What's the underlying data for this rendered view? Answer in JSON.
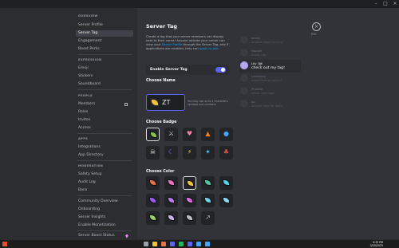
{
  "window": {
    "minimize_glyph": "–",
    "maximize_glyph": "□",
    "close_glyph": "×"
  },
  "sidebar": {
    "sections": [
      {
        "header": "Overview",
        "items": [
          {
            "label": "Server Profile"
          },
          {
            "label": "Server Tag",
            "active": true
          },
          {
            "label": "Engagement"
          },
          {
            "label": "Boost Perks"
          }
        ]
      },
      {
        "header": "Expression",
        "items": [
          {
            "label": "Emoji"
          },
          {
            "label": "Stickers"
          },
          {
            "label": "Soundboard"
          }
        ]
      },
      {
        "header": "People",
        "items": [
          {
            "label": "Members",
            "icon": "external-link-icon"
          },
          {
            "label": "Roles"
          },
          {
            "label": "Invites"
          },
          {
            "label": "Access"
          }
        ]
      },
      {
        "header": "Apps",
        "items": [
          {
            "label": "Integrations"
          },
          {
            "label": "App Directory"
          }
        ]
      },
      {
        "header": "Moderation",
        "items": [
          {
            "label": "Safety Setup"
          },
          {
            "label": "Audit Log"
          },
          {
            "label": "Bans"
          }
        ]
      },
      {
        "header": "",
        "items": [
          {
            "label": "Community Overview"
          },
          {
            "label": "Onboarding"
          },
          {
            "label": "Server Insights"
          },
          {
            "label": "Enable Monetization"
          }
        ]
      }
    ],
    "footer_item": {
      "label": "Server Boost Status",
      "icon": "nitro-gem-icon"
    }
  },
  "page": {
    "title": "Server Tag",
    "description_parts": [
      "Create a tag that your server members can display next to their name! Anyone outside your server can view your ",
      "Server Profile",
      " through the Server Tag, and if applications are enabled, they can ",
      "apply to join",
      "."
    ],
    "toggle": {
      "label": "Enable Server Tag",
      "enabled": true
    },
    "choose_name": {
      "heading": "Choose Name",
      "value": "ZT",
      "hint": "You may use up to 4 characters, symbols and numbers."
    },
    "choose_badge": {
      "heading": "Choose Badge"
    },
    "choose_color": {
      "heading": "Choose Color"
    },
    "close": {
      "glyph": "×",
      "label": "ESC"
    }
  },
  "badges": [
    {
      "icon": "leaf-icon",
      "glyph": "",
      "color": "#8bc34a",
      "selected": true
    },
    {
      "icon": "swords-icon",
      "glyph": "⚔",
      "color": "#cfd3d8"
    },
    {
      "icon": "heart-icon",
      "glyph": "♥",
      "color": "#f47fa4"
    },
    {
      "icon": "fire-icon",
      "glyph": "▲",
      "color": "#ff7a1a"
    },
    {
      "icon": "water-drop-icon",
      "glyph": "●",
      "color": "#3fa7ff"
    },
    {
      "icon": "skull-icon",
      "glyph": "☠",
      "color": "#e8e8e8"
    },
    {
      "icon": "moon-icon",
      "glyph": "☾",
      "color": "#8a7bff"
    },
    {
      "icon": "lightning-icon",
      "glyph": "⚡",
      "color": "#f5d142"
    },
    {
      "icon": "star-sparkle-icon",
      "glyph": "✦",
      "color": "#4fc3f7"
    },
    {
      "icon": "mushroom-icon",
      "glyph": "♣",
      "color": "#e84a4a"
    }
  ],
  "colors": [
    {
      "fill": "#e8734a"
    },
    {
      "fill": "#f06ec0"
    },
    {
      "fill": "#f0c23a",
      "selected": true
    },
    {
      "fill": "#4fc3a1"
    },
    {
      "fill": "#5ad0e8"
    },
    {
      "fill": "#9a5cf0"
    },
    {
      "fill": "#b77cf0"
    },
    {
      "fill": "#d96ee0"
    },
    {
      "fill": "#6fd4e8"
    },
    {
      "fill": "#8fd6f0"
    },
    {
      "fill": "#9ad06a"
    },
    {
      "fill": "#c9b2ea"
    },
    {
      "fill": "#b8bcc4"
    },
    {
      "custom": true,
      "icon": "eyedropper-icon",
      "glyph": "↗"
    }
  ],
  "preview": {
    "messages": [
      {
        "name": "Kenta",
        "text": "anyone down for arcs?",
        "highlight": false
      },
      {
        "name": "Noogie",
        "text": "Ready tok",
        "highlight": false
      },
      {
        "name": "Lily",
        "tag": "ZT",
        "text": "check out my tag!",
        "highlight": true
      },
      {
        "name": "Lacewing",
        "text": "would love an opt-in!",
        "highlight": false
      },
      {
        "name": "Phoebe",
        "text": "sweet new tags!",
        "highlight": false
      },
      {
        "name": "Ko",
        "text": "anyone here for later?",
        "highlight": false
      }
    ]
  },
  "taskbar": {
    "time": "9:33 PM",
    "date": "3/20/2025",
    "icons": [
      {
        "name": "search-icon",
        "color": "#9aa0a6"
      },
      {
        "name": "file-explorer-icon",
        "color": "#f0c23a"
      },
      {
        "name": "browser-icon",
        "color": "#e8734a"
      },
      {
        "name": "store-icon",
        "color": "#5865f2"
      },
      {
        "name": "music-icon",
        "color": "#1db954"
      },
      {
        "name": "discord-icon",
        "color": "#5865f2"
      },
      {
        "name": "mail-icon",
        "color": "#3fa7ff"
      },
      {
        "name": "code-editor-icon",
        "color": "#3fa7ff"
      }
    ]
  }
}
